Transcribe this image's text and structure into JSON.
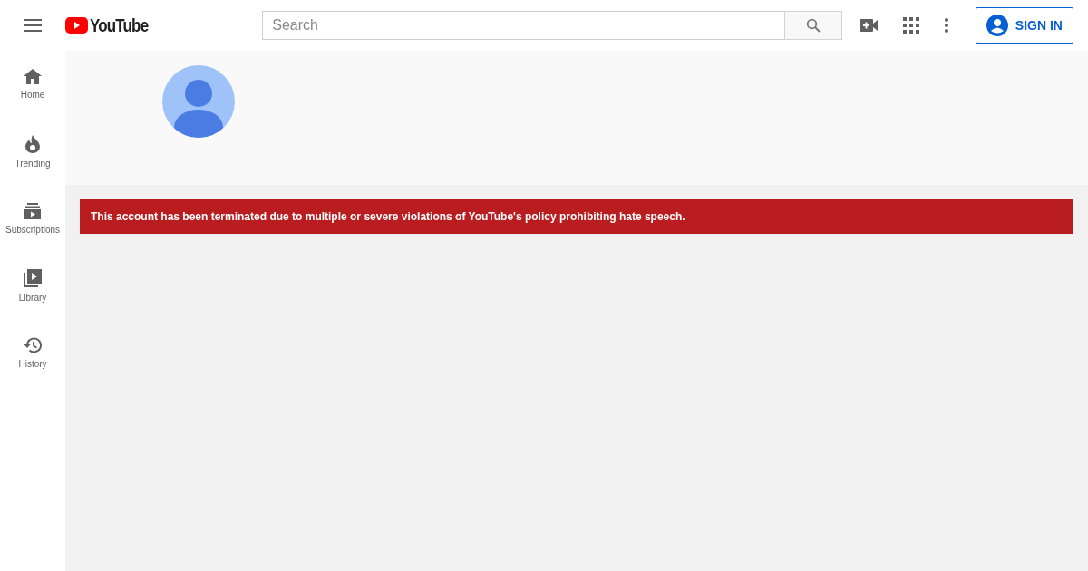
{
  "header": {
    "logo_text": "YouTube",
    "search": {
      "placeholder": "Search"
    },
    "sign_in": "SIGN IN"
  },
  "sidebar": {
    "items": [
      {
        "kind": "home",
        "label": "Home"
      },
      {
        "kind": "trending",
        "label": "Trending"
      },
      {
        "kind": "subscriptions",
        "label": "Subscriptions"
      },
      {
        "kind": "library",
        "label": "Library"
      },
      {
        "kind": "history",
        "label": "History"
      }
    ]
  },
  "alert": {
    "message": "This account has been terminated due to multiple or severe violations of YouTube's policy prohibiting hate speech."
  }
}
